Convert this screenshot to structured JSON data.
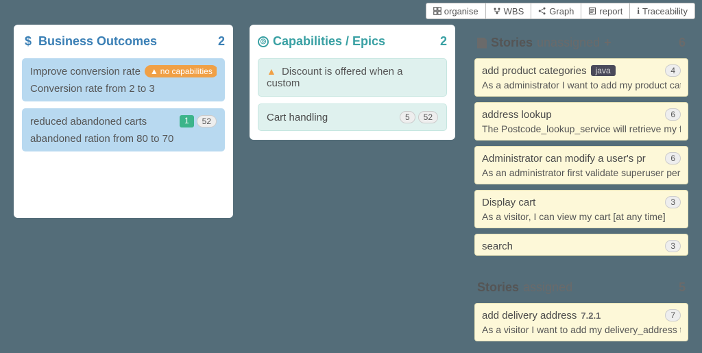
{
  "toolbar": {
    "organise": "organise",
    "wbs": "WBS",
    "graph": "Graph",
    "report": "report",
    "trace": "Traceability"
  },
  "outcomes": {
    "title": "Business Outcomes",
    "count": "2",
    "cards": [
      {
        "title": "Improve conversion rate",
        "warn": "no capabilities",
        "desc": "Conversion rate from 2 to 3"
      },
      {
        "title": "reduced abandoned carts",
        "green": "1",
        "effort": "52",
        "desc": "abandoned ration from 80 to 70"
      }
    ]
  },
  "capabilities": {
    "title": "Capabilities / Epics",
    "count": "2",
    "cards": [
      {
        "title": "Discount is offered when a custom",
        "warn": true
      },
      {
        "title": "Cart handling",
        "left": "5",
        "right": "52"
      }
    ]
  },
  "stories_unassigned": {
    "title": "Stories",
    "sub": "unassigned",
    "count": "6",
    "cards": [
      {
        "title": "add product categories",
        "tag": "java",
        "pts": "4",
        "desc": "As a administrator I want to add my product cate"
      },
      {
        "title": "address lookup",
        "pts": "6",
        "desc": "The Postcode_lookup_service will retrieve my ful"
      },
      {
        "title": "Administrator can modify a user's pr",
        "pts": "6",
        "desc": "As an administrator first validate superuser per"
      },
      {
        "title": "Display cart",
        "pts": "3",
        "desc": "As a visitor, I can view my cart [at any time]"
      },
      {
        "title": "search",
        "pts": "3",
        "desc": ""
      }
    ]
  },
  "stories_assigned": {
    "title": "Stories",
    "sub": "assigned",
    "count": "5",
    "cards": [
      {
        "title": "add delivery address",
        "ver": "7.2.1",
        "pts": "7",
        "desc": "As a visitor I want to add my delivery_address t"
      }
    ]
  }
}
